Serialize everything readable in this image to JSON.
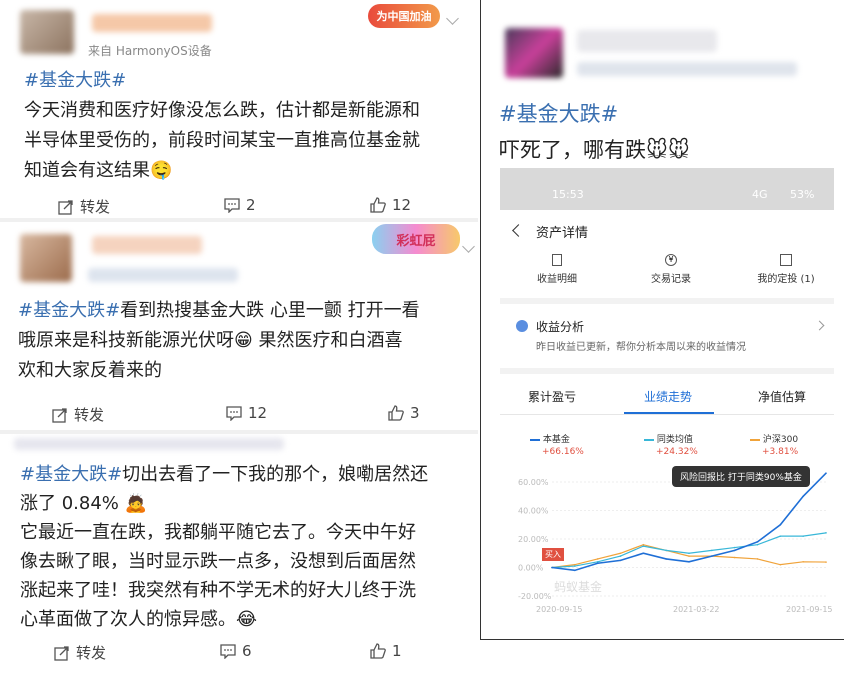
{
  "posts": [
    {
      "source": "来自 HarmonyOS设备",
      "badge": "为中国加油",
      "tag": "#基金大跌#",
      "line1": "今天消费和医疗好像没怎么跌，估计都是新能源和",
      "line2": "半导体里受伤的，前段时间某宝一直推高位基金就",
      "line3": "知道会有这结果",
      "emoji": "🤤",
      "repost": "转发",
      "comments": "2",
      "likes": "12"
    },
    {
      "badge": "彩虹屁",
      "tag": "#基金大跌#",
      "line1_rest": "看到热搜基金大跌 心里一颤  打开一看",
      "line2": "哦原来是科技新能源光伏呀",
      "emoji": "😁",
      "line2_rest": "果然医疗和白酒喜",
      "line3": "欢和大家反着来的",
      "repost": "转发",
      "comments": "12",
      "likes": "3"
    },
    {
      "tag": "#基金大跌#",
      "line1_rest": "切出去看了一下我的那个，娘嘞居然还",
      "line2": "涨了 0.84%",
      "emoji2": "🙇",
      "line3": "它最近一直在跌，我都躺平随它去了。今天中午好",
      "line4": "像去瞅了眼，当时显示跌一点多，没想到后面居然",
      "line5": "涨起来了哇！我突然有种不学无术的好大儿终于洗",
      "line6": "心革面做了次人的惊异感。",
      "emoji": "😂",
      "repost": "转发",
      "comments": "6",
      "likes": "1"
    }
  ],
  "right_post": {
    "tag": "#基金大跌#",
    "text": "吓死了，哪有跌",
    "emoji": "🐭🐭"
  },
  "phone": {
    "time": "15:53",
    "battery": "53%",
    "signal": "4G",
    "nav_title": "资产详情",
    "quick": [
      "收益明细",
      "交易记录",
      "我的定投 (1)"
    ],
    "analysis_title": "收益分析",
    "analysis_sub": "昨日收益已更新，帮你分析本周以来的收益情况",
    "tabs": [
      "累计盈亏",
      "业绩走势",
      "净值估算"
    ],
    "legend": [
      {
        "name": "本基金",
        "value": "+66.16%",
        "color": "#1f6fd6"
      },
      {
        "name": "同类均值",
        "value": "+24.32%",
        "color": "#38b7d8"
      },
      {
        "name": "沪深300",
        "value": "+3.81%",
        "color": "#f0a33a"
      }
    ],
    "tooltip": "风险回报比 打于同类90%基金",
    "buy_label": "买入",
    "watermark": "蚂蚁基金",
    "y_ticks": [
      "60.00%",
      "40.00%",
      "20.00%",
      "0.00%",
      "-20.00%"
    ],
    "x_ticks": [
      "2020-09-15",
      "2021-03-22",
      "2021-09-15"
    ]
  },
  "chart_data": {
    "type": "line",
    "x": [
      "2020-09-15",
      "2020-10-15",
      "2020-11-15",
      "2020-12-15",
      "2021-01-15",
      "2021-02-15",
      "2021-03-22",
      "2021-04-15",
      "2021-05-15",
      "2021-06-15",
      "2021-07-15",
      "2021-08-15",
      "2021-09-15"
    ],
    "series": [
      {
        "name": "本基金",
        "values": [
          0,
          -2,
          3,
          5,
          10,
          6,
          4,
          8,
          12,
          18,
          30,
          50,
          66.16
        ]
      },
      {
        "name": "同类均值",
        "values": [
          0,
          1,
          4,
          8,
          15,
          12,
          10,
          12,
          14,
          16,
          22,
          22,
          24.32
        ]
      },
      {
        "name": "沪深300",
        "values": [
          0,
          2,
          6,
          10,
          16,
          12,
          8,
          8,
          7,
          6,
          2,
          4,
          3.81
        ]
      }
    ],
    "ylim": [
      -20,
      60
    ],
    "grid": true
  }
}
